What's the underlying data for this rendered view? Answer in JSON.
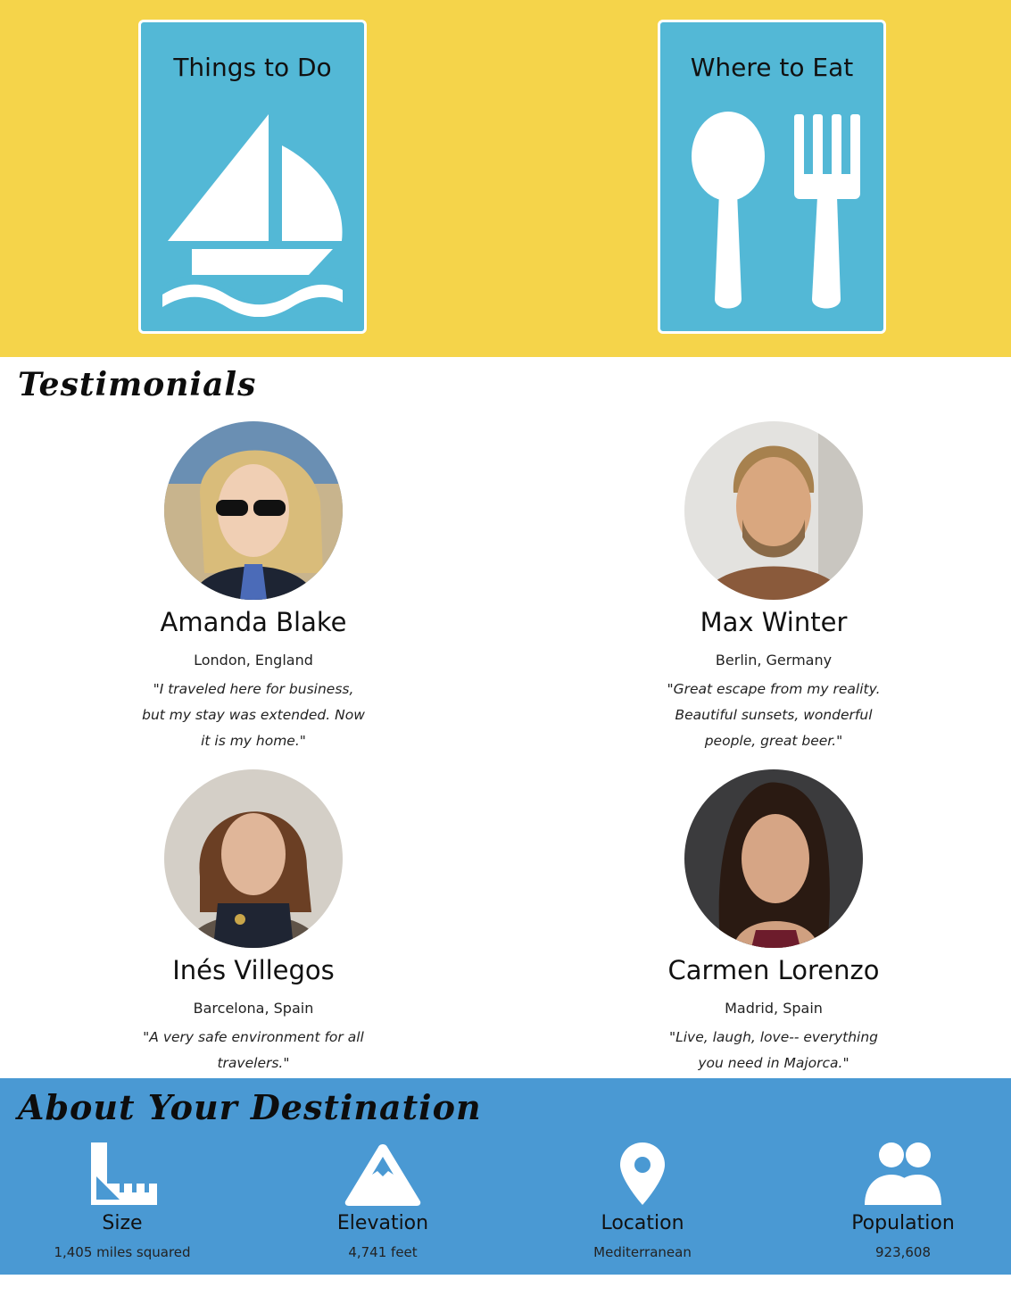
{
  "features": [
    {
      "title": "Things to Do",
      "icon": "sailboat-icon"
    },
    {
      "title": "Where to Eat",
      "icon": "spoon-fork-icon"
    }
  ],
  "testimonials": {
    "heading": "Testimonials",
    "people": [
      {
        "name": "Amanda Blake",
        "city": "London, England",
        "quote": "\"I traveled here for business, but my stay was extended. Now it is my home.\"",
        "avatar": "woman-sunglasses-photo"
      },
      {
        "name": "Max Winter",
        "city": "Berlin, Germany",
        "quote": "\"Great escape from my reality. Beautiful sunsets, wonderful people, great beer.\"",
        "avatar": "bearded-man-photo"
      },
      {
        "name": "Inés Villegos",
        "city": "Barcelona, Spain",
        "quote": "\"A very safe environment for all travelers.\"",
        "avatar": "woman-police-vest-photo"
      },
      {
        "name": "Carmen Lorenzo",
        "city": "Madrid, Spain",
        "quote": "\"Live, laugh, love-- everything you need in Majorca.\"",
        "avatar": "woman-dark-hair-photo"
      }
    ]
  },
  "about": {
    "heading": "About Your Destination",
    "stats": [
      {
        "label": "Size",
        "value": "1,405 miles squared",
        "icon": "ruler-icon"
      },
      {
        "label": "Elevation",
        "value": "4,741 feet",
        "icon": "mountain-icon"
      },
      {
        "label": "Location",
        "value": "Mediterranean",
        "icon": "map-pin-icon"
      },
      {
        "label": "Population",
        "value": "923,608",
        "icon": "people-icon"
      }
    ]
  },
  "colors": {
    "feature_band": "#f5d44a",
    "card": "#53b8d6",
    "about_band": "#4a99d3"
  }
}
